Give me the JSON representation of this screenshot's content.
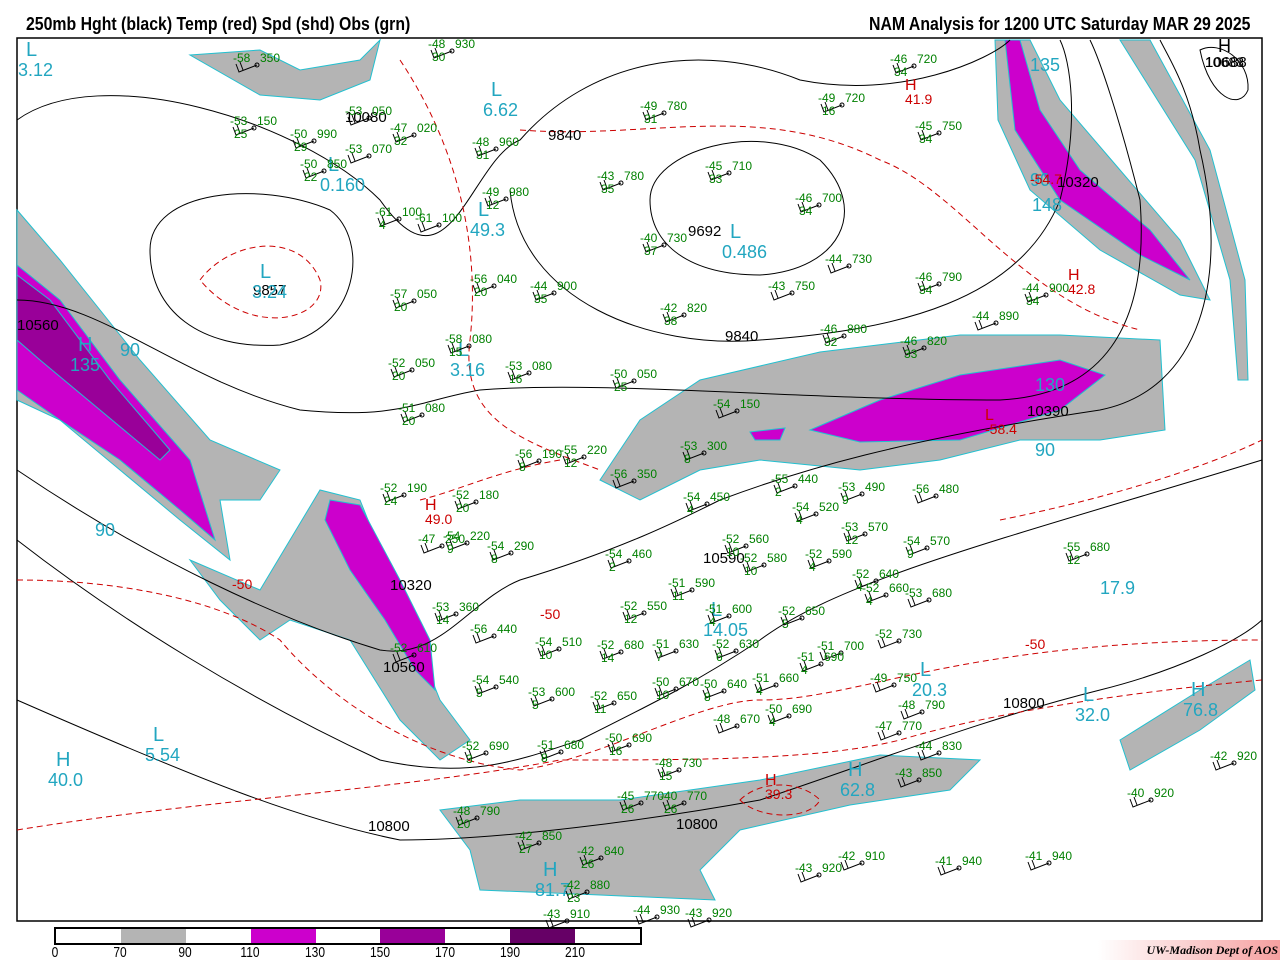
{
  "header": {
    "left": "250mb Hght (black) Temp (red) Spd (shd) Obs (grn)",
    "right": "NAM Analysis for 1200 UTC Saturday  MAR 29 2025"
  },
  "legend": {
    "labels": [
      "0",
      "70",
      "90",
      "110",
      "130",
      "150",
      "170",
      "190",
      "210"
    ],
    "colors": [
      "#ffffff",
      "#b4b4b4",
      "#ffffff",
      "#cc00cc",
      "#ffffff",
      "#990099",
      "#ffffff",
      "#660066",
      "#ffffff"
    ]
  },
  "credit": "UW-Madison   Dept of AOS",
  "colors": {
    "height": "#000000",
    "temp": "#cc0000",
    "obs": "#008000",
    "speed_label": "#22a6c0",
    "gray": "#b4b4b4",
    "magenta": "#cc00cc",
    "purple": "#990099"
  },
  "height_labels": [
    "9840",
    "9692",
    "9857",
    "10080",
    "10320",
    "10560",
    "10800",
    "10800",
    "10800",
    "10590",
    "10390",
    "10688",
    "10320",
    "9840",
    "10560"
  ],
  "centers": [
    {
      "l": "L",
      "v": "3.12"
    },
    {
      "l": "L",
      "v": "6.62"
    },
    {
      "l": "L",
      "v": "0.160"
    },
    {
      "l": "L",
      "v": "3.24"
    },
    {
      "l": "L",
      "v": "0.486"
    },
    {
      "l": "L",
      "v": "49.3"
    },
    {
      "l": "L",
      "v": "3.16"
    },
    {
      "l": "H",
      "v": "135"
    },
    {
      "l": "",
      "v": "90"
    },
    {
      "l": "L",
      "v": "14.05"
    },
    {
      "l": "L",
      "v": "20.3"
    },
    {
      "l": "",
      "v": "17.9"
    },
    {
      "l": "L",
      "v": "32.0"
    },
    {
      "l": "H",
      "v": "76.8"
    },
    {
      "l": "H",
      "v": "62.8"
    },
    {
      "l": "H",
      "v": "81.7"
    },
    {
      "l": "L",
      "v": "5.54"
    },
    {
      "l": "H",
      "v": "40.0"
    },
    {
      "l": "",
      "v": "90"
    },
    {
      "l": "",
      "v": "130"
    },
    {
      "l": "",
      "v": "90"
    },
    {
      "l": "",
      "v": "148"
    },
    {
      "l": "",
      "v": "135"
    },
    {
      "l": "",
      "v": "90"
    }
  ],
  "temp_labels": [
    {
      "l": "H",
      "v": "41.9"
    },
    {
      "l": "H",
      "v": "42.8"
    },
    {
      "l": "H",
      "v": "49.0"
    },
    {
      "l": "H",
      "v": "39.3"
    },
    {
      "l": "",
      "v": "-50"
    },
    {
      "l": "",
      "v": "-50"
    },
    {
      "l": "",
      "v": "-50"
    },
    {
      "l": "L",
      "v": "-58.4"
    },
    {
      "l": "",
      "v": "-54.7"
    }
  ],
  "extra_h": {
    "l": "H",
    "v": "10688"
  },
  "obs": [
    {
      "t": "-48",
      "h": "930",
      "d": "30"
    },
    {
      "t": "-58",
      "h": "350",
      "d": ""
    },
    {
      "t": "-53",
      "h": "050",
      "d": ""
    },
    {
      "t": "-53",
      "h": "150",
      "d": "25"
    },
    {
      "t": "-47",
      "h": "020",
      "d": "32"
    },
    {
      "t": "-50",
      "h": "990",
      "d": "29"
    },
    {
      "t": "-48",
      "h": "960",
      "d": "31"
    },
    {
      "t": "-53",
      "h": "070",
      "d": ""
    },
    {
      "t": "-50",
      "h": "850",
      "d": "22"
    },
    {
      "t": "-43",
      "h": "780",
      "d": "35"
    },
    {
      "t": "-45",
      "h": "710",
      "d": "33"
    },
    {
      "t": "-49",
      "h": "780",
      "d": "31"
    },
    {
      "t": "-49",
      "h": "720",
      "d": "16"
    },
    {
      "t": "-46",
      "h": "720",
      "d": "34"
    },
    {
      "t": "-45",
      "h": "750",
      "d": "34"
    },
    {
      "t": "-46",
      "h": "700",
      "d": "34"
    },
    {
      "t": "-49",
      "h": "980",
      "d": "12"
    },
    {
      "t": "-61",
      "h": "100",
      "d": "4"
    },
    {
      "t": "-61",
      "h": "100",
      "d": ""
    },
    {
      "t": "-40",
      "h": "730",
      "d": "37"
    },
    {
      "t": "-44",
      "h": "730",
      "d": ""
    },
    {
      "t": "-46",
      "h": "790",
      "d": "34"
    },
    {
      "t": "-44",
      "h": "900",
      "d": "34"
    },
    {
      "t": "-44",
      "h": "900",
      "d": "35"
    },
    {
      "t": "-56",
      "h": "040",
      "d": "20"
    },
    {
      "t": "-43",
      "h": "750",
      "d": ""
    },
    {
      "t": "-42",
      "h": "820",
      "d": "38"
    },
    {
      "t": "-44",
      "h": "890",
      "d": ""
    },
    {
      "t": "-57",
      "h": "050",
      "d": "20"
    },
    {
      "t": "-46",
      "h": "880",
      "d": "32"
    },
    {
      "t": "-46",
      "h": "820",
      "d": "33"
    },
    {
      "t": "-58",
      "h": "080",
      "d": "15"
    },
    {
      "t": "-52",
      "h": "050",
      "d": "20"
    },
    {
      "t": "-53",
      "h": "080",
      "d": "16"
    },
    {
      "t": "-50",
      "h": "050",
      "d": "25"
    },
    {
      "t": "-51",
      "h": "080",
      "d": "20"
    },
    {
      "t": "-54",
      "h": "150",
      "d": ""
    },
    {
      "t": "-53",
      "h": "300",
      "d": "8"
    },
    {
      "t": "-56",
      "h": "190",
      "d": "8"
    },
    {
      "t": "-55",
      "h": "220",
      "d": "12"
    },
    {
      "t": "-56",
      "h": "350",
      "d": ""
    },
    {
      "t": "-52",
      "h": "190",
      "d": "24"
    },
    {
      "t": "-52",
      "h": "180",
      "d": "20"
    },
    {
      "t": "-55",
      "h": "440",
      "d": "2"
    },
    {
      "t": "-53",
      "h": "490",
      "d": "9"
    },
    {
      "t": "-56",
      "h": "480",
      "d": ""
    },
    {
      "t": "-54",
      "h": "450",
      "d": "4"
    },
    {
      "t": "-54",
      "h": "520",
      "d": "4"
    },
    {
      "t": "-53",
      "h": "570",
      "d": "12"
    },
    {
      "t": "-54",
      "h": "570",
      "d": "9"
    },
    {
      "t": "-47",
      "h": "250",
      "d": ""
    },
    {
      "t": "-54",
      "h": "220",
      "d": "9"
    },
    {
      "t": "-54",
      "h": "290",
      "d": "8"
    },
    {
      "t": "-52",
      "h": "560",
      "d": "10"
    },
    {
      "t": "-52",
      "h": "580",
      "d": "10"
    },
    {
      "t": "-52",
      "h": "590",
      "d": "4"
    },
    {
      "t": "-54",
      "h": "460",
      "d": "2"
    },
    {
      "t": "-52",
      "h": "640",
      "d": "4"
    },
    {
      "t": "-52",
      "h": "660",
      "d": "4"
    },
    {
      "t": "-53",
      "h": "680",
      "d": ""
    },
    {
      "t": "-51",
      "h": "590",
      "d": "11"
    },
    {
      "t": "-53",
      "h": "360",
      "d": "14"
    },
    {
      "t": "-52",
      "h": "550",
      "d": "12"
    },
    {
      "t": "-51",
      "h": "600",
      "d": "4"
    },
    {
      "t": "-52",
      "h": "650",
      "d": "5"
    },
    {
      "t": "-56",
      "h": "440",
      "d": ""
    },
    {
      "t": "-54",
      "h": "510",
      "d": "10"
    },
    {
      "t": "-52",
      "h": "680",
      "d": "14"
    },
    {
      "t": "-51",
      "h": "630",
      "d": "7"
    },
    {
      "t": "-52",
      "h": "630",
      "d": "6"
    },
    {
      "t": "-52",
      "h": "730",
      "d": ""
    },
    {
      "t": "-51",
      "h": "700",
      "d": ""
    },
    {
      "t": "-51",
      "h": "690",
      "d": "4"
    },
    {
      "t": "-52",
      "h": "610",
      "d": ""
    },
    {
      "t": "-54",
      "h": "540",
      "d": "5"
    },
    {
      "t": "-50",
      "h": "670",
      "d": "10"
    },
    {
      "t": "-50",
      "h": "640",
      "d": "8"
    },
    {
      "t": "-51",
      "h": "660",
      "d": "4"
    },
    {
      "t": "-49",
      "h": "750",
      "d": ""
    },
    {
      "t": "-53",
      "h": "600",
      "d": "5"
    },
    {
      "t": "-52",
      "h": "650",
      "d": "11"
    },
    {
      "t": "-48",
      "h": "670",
      "d": ""
    },
    {
      "t": "-50",
      "h": "690",
      "d": "4"
    },
    {
      "t": "-48",
      "h": "790",
      "d": ""
    },
    {
      "t": "-47",
      "h": "770",
      "d": ""
    },
    {
      "t": "-52",
      "h": "690",
      "d": "3"
    },
    {
      "t": "-51",
      "h": "680",
      "d": "8"
    },
    {
      "t": "-50",
      "h": "690",
      "d": "16"
    },
    {
      "t": "-44",
      "h": "830",
      "d": ""
    },
    {
      "t": "-48",
      "h": "730",
      "d": "15"
    },
    {
      "t": "-43",
      "h": "850",
      "d": ""
    },
    {
      "t": "-42",
      "h": "920",
      "d": ""
    },
    {
      "t": "-45",
      "h": "770",
      "d": "26"
    },
    {
      "t": "-40",
      "h": "770",
      "d": "26"
    },
    {
      "t": "-40",
      "h": "920",
      "d": ""
    },
    {
      "t": "-48",
      "h": "790",
      "d": "20"
    },
    {
      "t": "-42",
      "h": "850",
      "d": "27"
    },
    {
      "t": "-42",
      "h": "840",
      "d": "26"
    },
    {
      "t": "-42",
      "h": "910",
      "d": ""
    },
    {
      "t": "-43",
      "h": "920",
      "d": ""
    },
    {
      "t": "-41",
      "h": "940",
      "d": ""
    },
    {
      "t": "-41",
      "h": "940",
      "d": ""
    },
    {
      "t": "-42",
      "h": "880",
      "d": "23"
    },
    {
      "t": "-43",
      "h": "910",
      "d": ""
    },
    {
      "t": "-44",
      "h": "930",
      "d": ""
    },
    {
      "t": "-43",
      "h": "920",
      "d": ""
    },
    {
      "t": "-55",
      "h": "680",
      "d": "12"
    }
  ]
}
